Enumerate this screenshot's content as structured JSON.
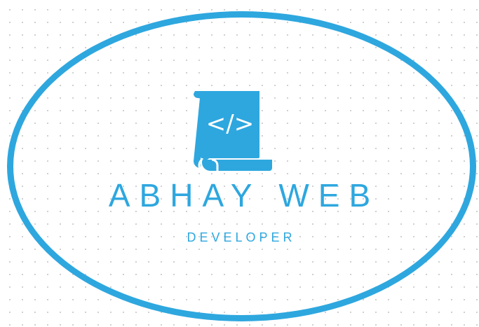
{
  "brand": {
    "name": "ABHAY WEB",
    "tagline": "DEVELOPER",
    "code_symbol": "</>",
    "icon": "scroll-code-icon",
    "accent_color": "#2ea7df"
  }
}
